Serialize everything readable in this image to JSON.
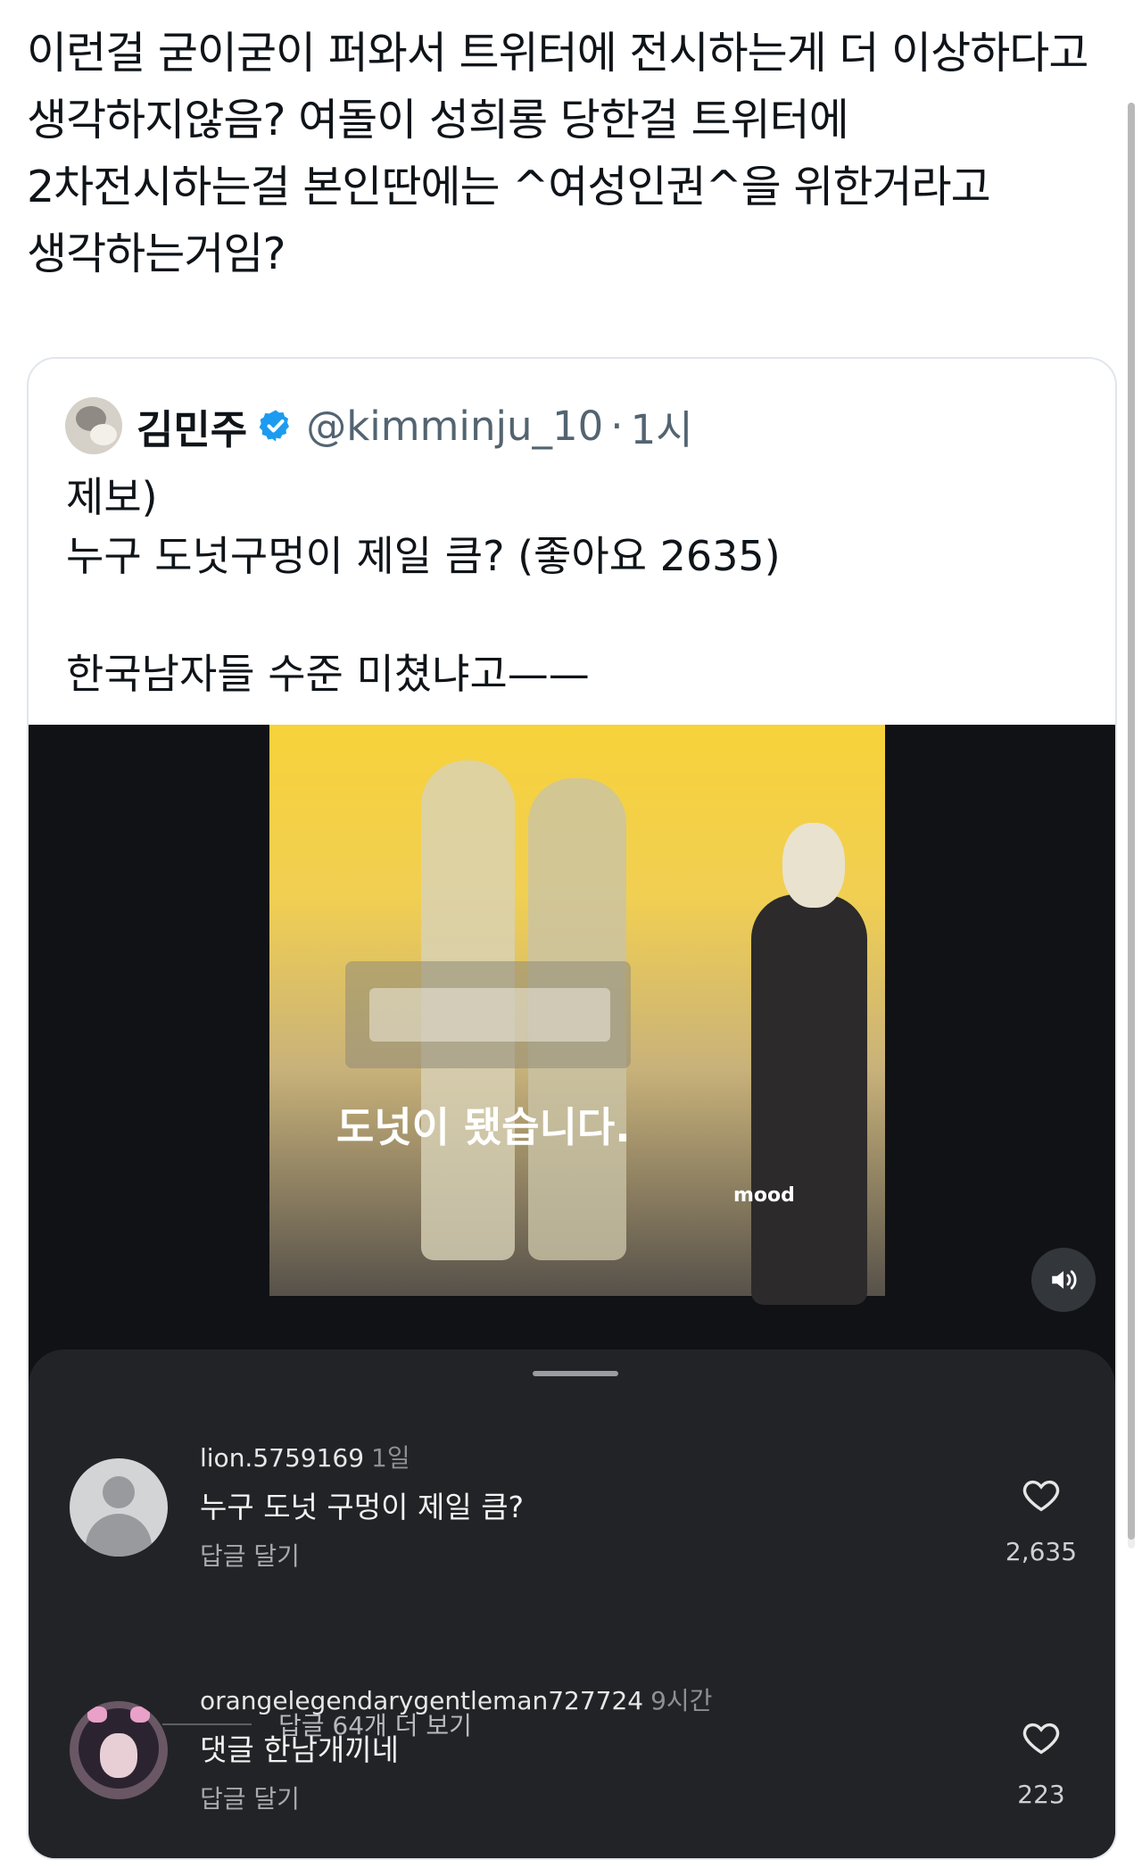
{
  "post": {
    "text": "이런걸 굳이굳이 퍼와서 트위터에 전시하는게 더 이상하다고 생각하지않음? 여돌이 성희롱 당한걸 트위터에 2차전시하는걸 본인딴에는 ^여성인권^을 위한거라고 생각하는거임?"
  },
  "quote": {
    "name": "김민주",
    "handle": "@kimminju_10",
    "separator": "·",
    "time": "1시",
    "body": "제보)\n누구 도넛구멍이 제일 큼? (좋아요 2635)\n\n한국남자들 수준 미쳤냐고——"
  },
  "video": {
    "caption": "도넛이 됐습니다.",
    "watermark": "mood"
  },
  "comments": [
    {
      "username": "lion.5759169",
      "time": "1일",
      "text": "누구 도넛 구멍이 제일 큼?",
      "reply_label": "답글 달기",
      "likes": "2,635",
      "more_replies": "답글 64개 더 보기"
    },
    {
      "username": "orangelegendarygentleman727724",
      "time": "9시간",
      "text": "댓글 한남개끼네",
      "reply_label": "답글 달기",
      "likes": "223"
    }
  ],
  "colors": {
    "verified": "#1d9bf0",
    "muted": "#536471",
    "sheet": "#222326",
    "media_bg": "#111215"
  },
  "icons": {
    "verified": "verified-badge-icon",
    "sound": "speaker-icon",
    "like": "heart-icon"
  }
}
